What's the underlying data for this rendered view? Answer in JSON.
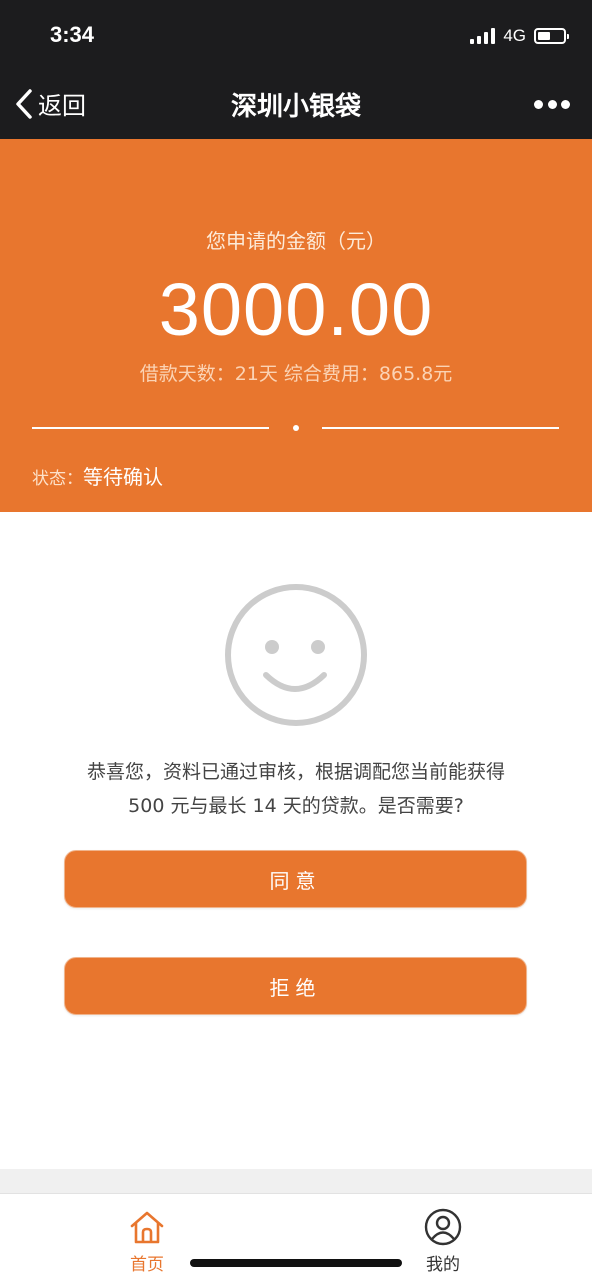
{
  "status_bar": {
    "time": "3:34",
    "network": "4G"
  },
  "nav": {
    "back_label": "返回",
    "title": "深圳小银袋"
  },
  "hero": {
    "label": "您申请的金额（元）",
    "amount": "3000.00",
    "detail": "借款天数：21天 综合费用：865.8元",
    "status_label": "状态：",
    "status_value": "等待确认"
  },
  "message": {
    "line1": "恭喜您，资料已通过审核，根据调配您当前能获得",
    "line2": "500 元与最长 14 天的贷款。是否需要?"
  },
  "buttons": {
    "agree": "同意",
    "reject": "拒绝"
  },
  "tabs": {
    "home": "首页",
    "mine": "我的"
  },
  "colors": {
    "accent": "#e8762e",
    "nav_bg": "#1c1c1e",
    "smiley": "#cccccc"
  },
  "icons": {
    "back": "chevron-left-icon",
    "more": "more-dots-icon",
    "smiley": "smiley-face-icon",
    "home": "home-icon",
    "user": "user-icon"
  }
}
